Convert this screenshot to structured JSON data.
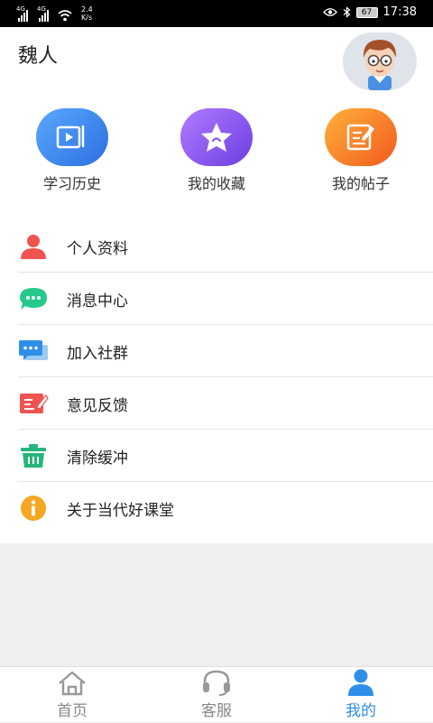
{
  "status_bar": {
    "net_speed_value": "2.4",
    "net_speed_unit": "K/s",
    "battery": "67",
    "time": "17:38"
  },
  "profile": {
    "username": "魏人"
  },
  "shortcuts": [
    {
      "label": "学习历史",
      "icon": "play-video-icon",
      "color": "#3d8af0"
    },
    {
      "label": "我的收藏",
      "icon": "star-icon",
      "color": "#8a5bf0"
    },
    {
      "label": "我的帖子",
      "icon": "edit-note-icon",
      "color": "#f77a2a"
    }
  ],
  "menu": [
    {
      "label": "个人资料",
      "icon": "person-icon",
      "color": "#ef5350"
    },
    {
      "label": "消息中心",
      "icon": "chat-bubble-icon",
      "color": "#26c98a"
    },
    {
      "label": "加入社群",
      "icon": "group-chat-icon",
      "color": "#2f8fe8"
    },
    {
      "label": "意见反馈",
      "icon": "feedback-icon",
      "color": "#ef5350"
    },
    {
      "label": "清除缓冲",
      "icon": "trash-icon",
      "color": "#26b57a"
    },
    {
      "label": "关于当代好课堂",
      "icon": "info-icon",
      "color": "#f5a623"
    }
  ],
  "tabbar": {
    "tabs": [
      {
        "label": "首页",
        "icon": "home-icon",
        "active": false
      },
      {
        "label": "客服",
        "icon": "headset-icon",
        "active": false
      },
      {
        "label": "我的",
        "icon": "person-icon",
        "active": true
      }
    ],
    "active_color": "#2f8fe8",
    "inactive_color": "#888888"
  }
}
